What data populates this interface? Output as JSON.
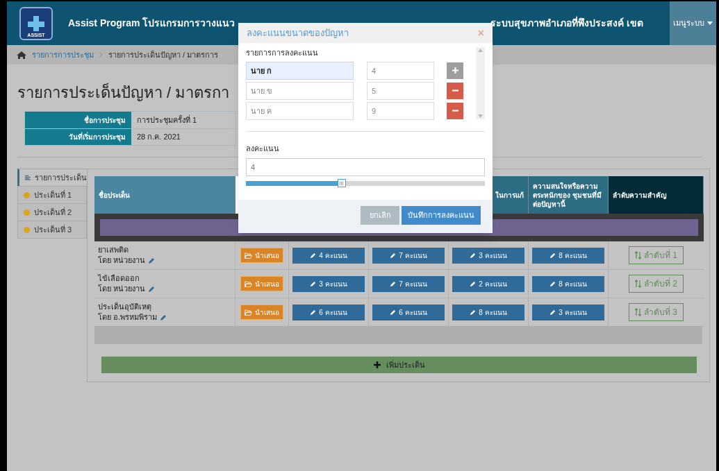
{
  "header": {
    "logo_text": "ASSIST",
    "title_left": "Assist Program โปรแกรมการวางแนว",
    "title_right": "ระบบสุขภาพอำเภอที่พึงประสงค์ เขต",
    "menu": "เมนูระบบ"
  },
  "breadcrumb": [
    {
      "label": "รายการการประชุม",
      "kind": "link"
    },
    {
      "label": "รายการประเด็นปัญหา / มาตรการ",
      "kind": "current"
    }
  ],
  "page_title": "รายการประเด็นปัญหา / มาตรกา",
  "meeting_info": [
    {
      "label": "ชื่อการประชุม",
      "value": "การประชุมครั้งที่ 1"
    },
    {
      "label": "วันที่เริ่มการประชุม",
      "value": "28 ก.ค. 2021"
    }
  ],
  "sidebar": {
    "items": [
      {
        "label": "รายการประเด็น",
        "kind": "header",
        "selected": true
      },
      {
        "label": "ประเด็นที่ 1",
        "kind": "item",
        "selected": false
      },
      {
        "label": "ประเด็นที่ 2",
        "kind": "item",
        "selected": false
      },
      {
        "label": "ประเด็นที่ 3",
        "kind": "item",
        "selected": false
      }
    ]
  },
  "table": {
    "columns": {
      "column_1": "ชื่อประเด็น",
      "column_5": "ในการแก้",
      "column_6": "ความสนใจหรือความตระหนักของ ชุมชนที่มีต่อปัญหานี้",
      "column_7": "ลำดับความสำคัญ"
    },
    "rows": [
      {
        "title": "ยาเสพติด",
        "owner": "โดย หน่วยงาน",
        "present": "นำเสนอ",
        "scores": [
          "4 คะแนน",
          "7 คะแนน",
          "3 คะแนน",
          "8 คะแนน"
        ],
        "rank": "ลำดับที่ 1"
      },
      {
        "title": "ไข้เลือดออก",
        "owner": "โดย หน่วยงาน",
        "present": "นำเสนอ",
        "scores": [
          "3 คะแนน",
          "7 คะแนน",
          "2 คะแนน",
          "8 คะแนน"
        ],
        "rank": "ลำดับที่ 2"
      },
      {
        "title": "ประเด็นอุบัติเหตุ",
        "owner": "โดย อ.พรหมพิราม",
        "present": "นำเสนอ",
        "scores": [
          "6 คะแนน",
          "6 คะแนน",
          "8 คะแนน",
          "3 คะแนน"
        ],
        "rank": "ลำดับที่ 3"
      }
    ],
    "add_button": "เพิ่มประเด็น"
  },
  "modal": {
    "title": "ลงคะแนนขนาดของปัญหา",
    "close": "×",
    "list_label": "รายการการลงคะแนน",
    "voters": [
      {
        "name": "นาย ก",
        "score": "4",
        "kind": "add",
        "focused": true
      },
      {
        "name": "นาย ข",
        "score": "5",
        "kind": "remove",
        "focused": false
      },
      {
        "name": "นาย ค",
        "score": "9",
        "kind": "remove",
        "focused": false
      }
    ],
    "vote_label": "ลงคะแนน",
    "vote_value": "4",
    "level": 0.4,
    "cancel": "ยกเลิก",
    "save": "บันทึกการลงคะแนน"
  }
}
